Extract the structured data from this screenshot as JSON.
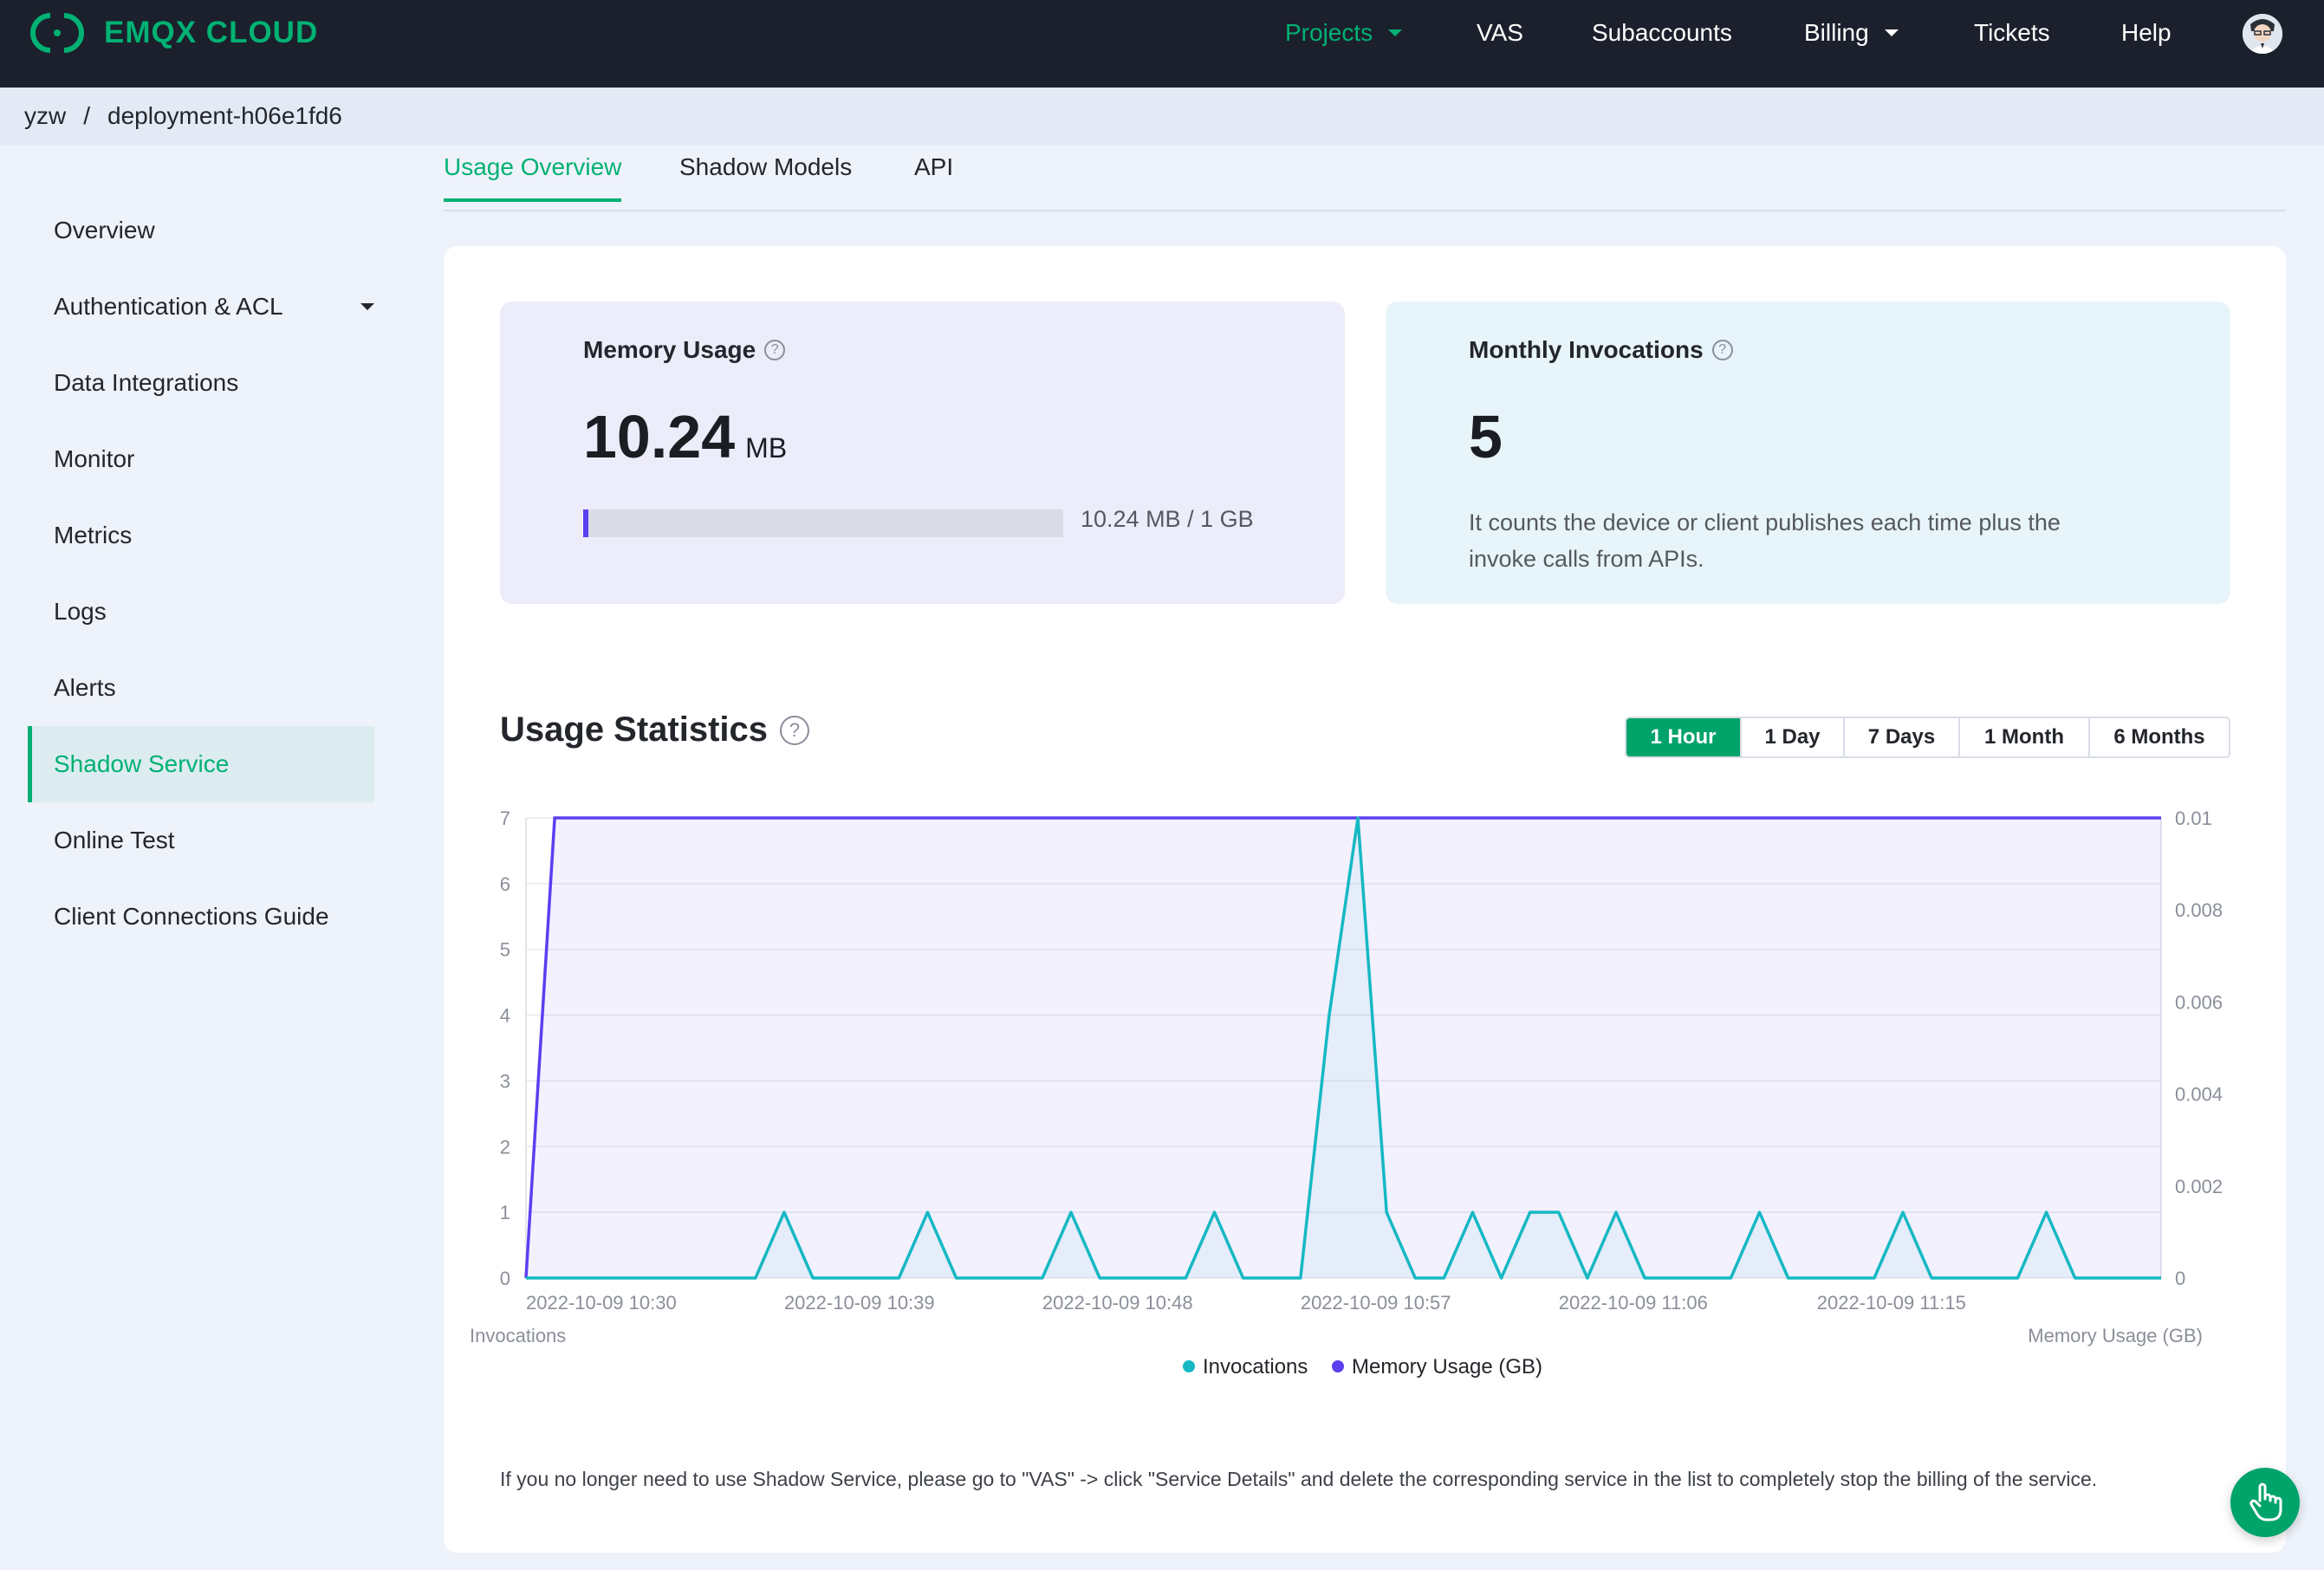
{
  "brand": {
    "name": "EMQX CLOUD",
    "accent": "#00b173"
  },
  "nav": {
    "items": [
      {
        "label": "Projects",
        "active": true,
        "dropdown": true
      },
      {
        "label": "VAS"
      },
      {
        "label": "Subaccounts"
      },
      {
        "label": "Billing",
        "dropdown": true
      },
      {
        "label": "Tickets"
      },
      {
        "label": "Help"
      }
    ]
  },
  "breadcrumb": {
    "project": "yzw",
    "separator": "/",
    "deployment": "deployment-h06e1fd6"
  },
  "sidebar": {
    "items": [
      {
        "label": "Overview"
      },
      {
        "label": "Authentication & ACL",
        "expandable": true
      },
      {
        "label": "Data Integrations"
      },
      {
        "label": "Monitor"
      },
      {
        "label": "Metrics"
      },
      {
        "label": "Logs"
      },
      {
        "label": "Alerts"
      },
      {
        "label": "Shadow Service",
        "active": true
      },
      {
        "label": "Online Test"
      },
      {
        "label": "Client Connections Guide"
      }
    ]
  },
  "tabs": [
    {
      "label": "Usage Overview",
      "active": true
    },
    {
      "label": "Shadow Models"
    },
    {
      "label": "API"
    }
  ],
  "memory": {
    "title": "Memory Usage",
    "value": "10.24",
    "unit": "MB",
    "progress_fraction": 0.0098,
    "progress_text": "10.24 MB / 1 GB"
  },
  "invocations": {
    "title": "Monthly Invocations",
    "value": "5",
    "description": "It counts the device or client publishes each time plus the invoke calls from APIs."
  },
  "stats": {
    "title": "Usage Statistics",
    "ranges": [
      {
        "label": "1 Hour",
        "active": true
      },
      {
        "label": "1 Day"
      },
      {
        "label": "7 Days"
      },
      {
        "label": "1 Month"
      },
      {
        "label": "6 Months"
      }
    ]
  },
  "chart_data": {
    "type": "line",
    "x_tick_labels": [
      "2022-10-09 10:30",
      "2022-10-09 10:39",
      "2022-10-09 10:48",
      "2022-10-09 10:57",
      "2022-10-09 11:06",
      "2022-10-09 11:15"
    ],
    "y_left_label": "Invocations",
    "y_right_label": "Memory Usage (GB)",
    "y_left_ticks": [
      0,
      1,
      2,
      3,
      4,
      5,
      6,
      7
    ],
    "y_right_ticks": [
      "0",
      "0.002",
      "0.004",
      "0.006",
      "0.008",
      "0.01"
    ],
    "ylim_left": [
      0,
      7
    ],
    "ylim_right": [
      0,
      0.01
    ],
    "x_range_minutes": [
      0,
      57
    ],
    "series": [
      {
        "name": "Invocations",
        "color": "#16b8c3",
        "axis": "left",
        "points": [
          [
            0,
            0
          ],
          [
            8,
            0
          ],
          [
            9,
            1
          ],
          [
            10,
            0
          ],
          [
            13,
            0
          ],
          [
            14,
            1
          ],
          [
            15,
            0
          ],
          [
            18,
            0
          ],
          [
            19,
            1
          ],
          [
            20,
            0
          ],
          [
            23,
            0
          ],
          [
            24,
            1
          ],
          [
            25,
            0
          ],
          [
            27,
            0
          ],
          [
            28,
            4
          ],
          [
            29,
            7
          ],
          [
            30,
            1
          ],
          [
            31,
            0
          ],
          [
            32,
            0
          ],
          [
            33,
            1
          ],
          [
            34,
            0
          ],
          [
            35,
            1
          ],
          [
            36,
            1
          ],
          [
            37,
            0
          ],
          [
            38,
            1
          ],
          [
            39,
            0
          ],
          [
            42,
            0
          ],
          [
            43,
            1
          ],
          [
            44,
            0
          ],
          [
            47,
            0
          ],
          [
            48,
            1
          ],
          [
            49,
            0
          ],
          [
            52,
            0
          ],
          [
            53,
            1
          ],
          [
            54,
            0
          ],
          [
            57,
            0
          ]
        ]
      },
      {
        "name": "Memory Usage (GB)",
        "color": "#5b3ff0",
        "axis": "right",
        "points": [
          [
            0,
            0
          ],
          [
            1,
            0.01
          ],
          [
            57,
            0.01
          ]
        ]
      }
    ],
    "legend_placement": "bottom-center",
    "grid": true
  },
  "footnote": "If you no longer need to use Shadow Service, please go to \"VAS\" -> click \"Service Details\" and delete the corresponding service in the list to completely stop the billing of the service."
}
